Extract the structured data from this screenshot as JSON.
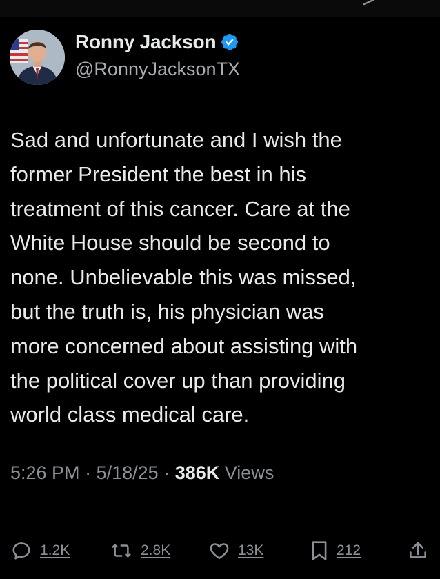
{
  "author": {
    "display_name": "Ronny Jackson",
    "handle": "@RonnyJacksonTX",
    "verified": true,
    "verified_color": "#1d9bf0"
  },
  "tweet": {
    "text": "Sad and unfortunate and I wish the\nformer President the best in his\ntreatment of this cancer. Care at the\nWhite House should be second to\nnone. Unbelievable this was missed,\nbut the truth is, his physician was\nmore concerned about assisting with\nthe political cover up than providing\nworld class medical care.",
    "time": "5:26 PM",
    "date": "5/18/25",
    "separator": "·",
    "views_count": "386K",
    "views_label": "Views"
  },
  "actions": {
    "reply": {
      "icon": "reply-icon",
      "count": "1.2K"
    },
    "repost": {
      "icon": "repost-icon",
      "count": "2.8K"
    },
    "like": {
      "icon": "heart-icon",
      "count": "13K"
    },
    "bookmark": {
      "icon": "bookmark-icon",
      "count": "212"
    },
    "share": {
      "icon": "share-icon"
    }
  },
  "colors": {
    "background": "#000000",
    "primary_text": "#e7e9ea",
    "secondary_text": "#8b9096"
  }
}
